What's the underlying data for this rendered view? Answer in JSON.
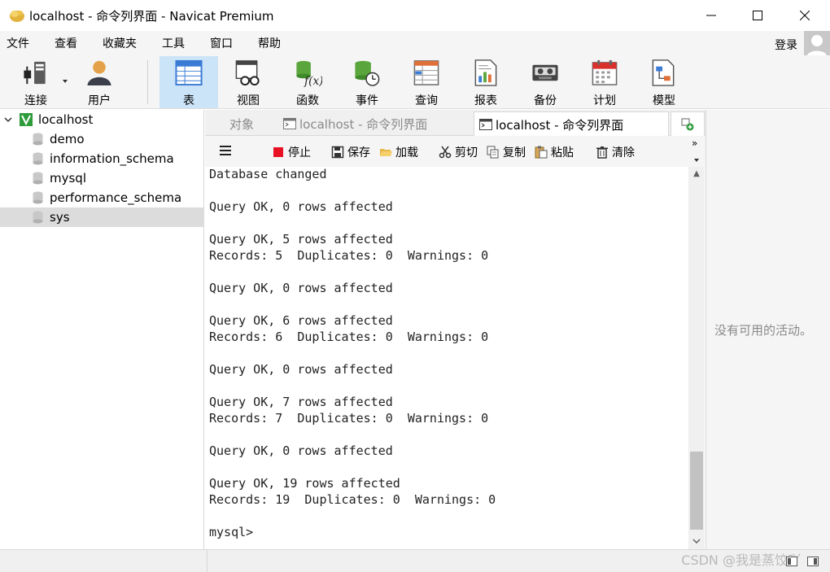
{
  "window": {
    "title": "localhost - 命令列界面 - Navicat Premium",
    "controls": [
      "minimize-icon",
      "maximize-icon",
      "close-icon"
    ]
  },
  "menu": {
    "items": [
      "文件",
      "查看",
      "收藏夹",
      "工具",
      "窗口",
      "帮助"
    ],
    "login": "登录"
  },
  "toolbar": {
    "buttons": [
      {
        "label": "连接",
        "icon": "plug-icon"
      },
      {
        "label": "用户",
        "icon": "user-icon"
      },
      {
        "label": "表",
        "icon": "table-icon",
        "active": true
      },
      {
        "label": "视图",
        "icon": "view-icon"
      },
      {
        "label": "函数",
        "icon": "function-icon"
      },
      {
        "label": "事件",
        "icon": "event-icon"
      },
      {
        "label": "查询",
        "icon": "query-icon"
      },
      {
        "label": "报表",
        "icon": "report-icon"
      },
      {
        "label": "备份",
        "icon": "backup-icon"
      },
      {
        "label": "计划",
        "icon": "calendar-icon"
      },
      {
        "label": "模型",
        "icon": "model-icon"
      }
    ]
  },
  "tree": {
    "connection": "localhost",
    "databases": [
      "demo",
      "information_schema",
      "mysql",
      "performance_schema",
      "sys"
    ],
    "selected": "sys"
  },
  "tabs": {
    "objects": "对象",
    "tab1": "localhost - 命令列界面",
    "tab2": "localhost - 命令列界面"
  },
  "commands": {
    "stop": "停止",
    "save": "保存",
    "load": "加载",
    "cut": "剪切",
    "copy": "复制",
    "paste": "粘贴",
    "clear": "清除"
  },
  "console": {
    "text": "Database changed\n\nQuery OK, 0 rows affected\n\nQuery OK, 5 rows affected\nRecords: 5  Duplicates: 0  Warnings: 0\n\nQuery OK, 0 rows affected\n\nQuery OK, 6 rows affected\nRecords: 6  Duplicates: 0  Warnings: 0\n\nQuery OK, 0 rows affected\n\nQuery OK, 7 rows affected\nRecords: 7  Duplicates: 0  Warnings: 0\n\nQuery OK, 0 rows affected\n\nQuery OK, 19 rows affected\nRecords: 19  Duplicates: 0  Warnings: 0\n\nmysql>"
  },
  "right_panel": {
    "message": "没有可用的活动。"
  },
  "watermark": "CSDN @我是蒸饺吖",
  "colors": {
    "active_toolbar": "#cce4f7",
    "accent_green": "#2e9b3a",
    "stop_red": "#e81123"
  }
}
